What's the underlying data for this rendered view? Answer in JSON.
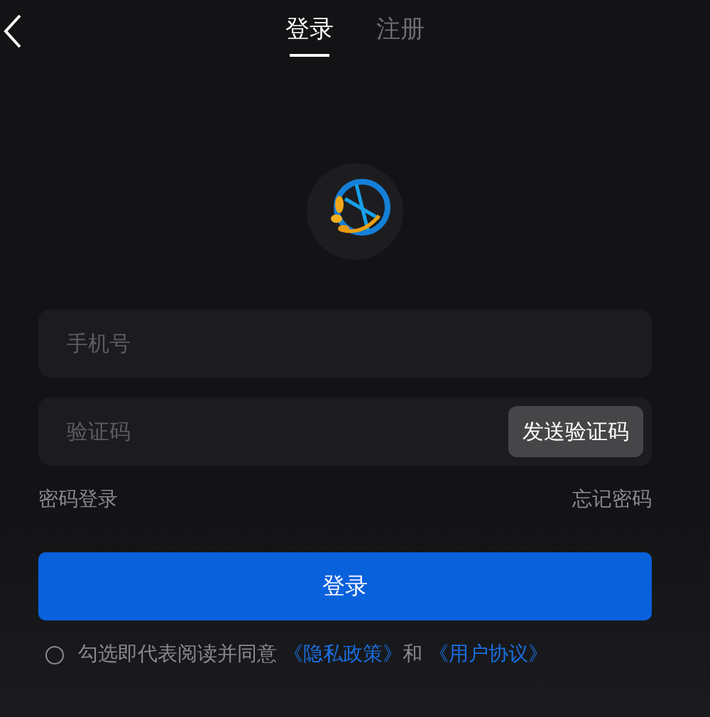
{
  "tabs": [
    {
      "label": "登录",
      "selected": true
    },
    {
      "label": "注册",
      "selected": false
    }
  ],
  "phone_field": {
    "placeholder": "手机号"
  },
  "code_field": {
    "placeholder": "验证码",
    "send_button": "发送验证码"
  },
  "password_login_link": "密码登录",
  "forgot_password_link": "忘记密码",
  "login_button": "登录",
  "agreement": {
    "checked": false,
    "text": "勾选即代表阅读并同意",
    "privacy_link": "《隐私政策》",
    "conjunction": "和",
    "terms_link": "《用户协议》"
  }
}
